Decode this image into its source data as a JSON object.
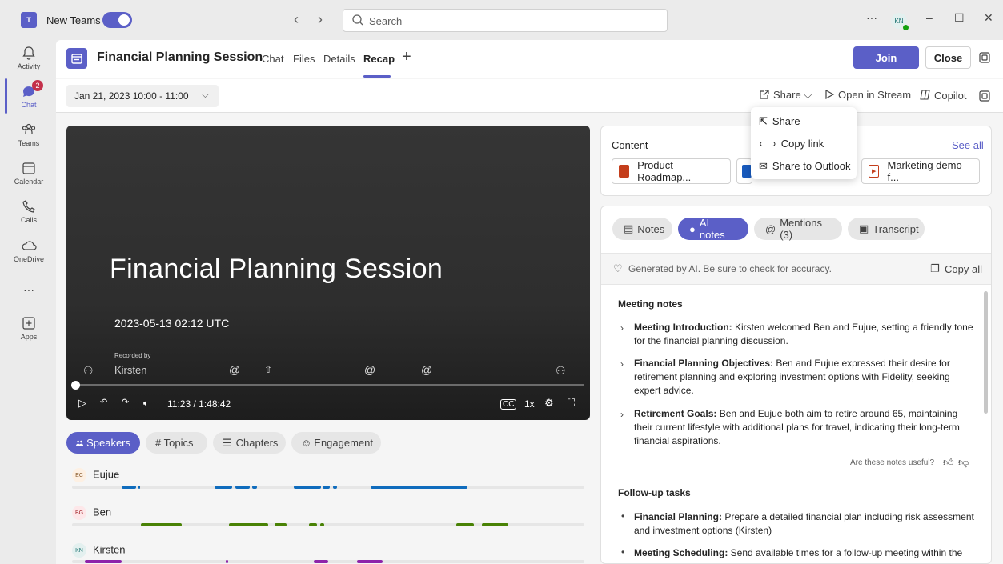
{
  "titlebar": {
    "app_label": "New Teams",
    "search_placeholder": "Search",
    "more": "···",
    "user_initials": "KN",
    "minimize": "–",
    "maximize": "☐",
    "close": "✕"
  },
  "rail": {
    "items": [
      {
        "label": "Activity"
      },
      {
        "label": "Chat",
        "badge": "2"
      },
      {
        "label": "Teams"
      },
      {
        "label": "Calendar"
      },
      {
        "label": "Calls"
      },
      {
        "label": "OneDrive"
      },
      {
        "label": "···"
      },
      {
        "label": "Apps"
      }
    ]
  },
  "header": {
    "title": "Financial Planning Session",
    "tabs": [
      {
        "label": "Chat"
      },
      {
        "label": "Files"
      },
      {
        "label": "Details"
      },
      {
        "label": "Recap",
        "active": true
      }
    ],
    "join_label": "Join",
    "close_label": "Close"
  },
  "toolbar": {
    "date_range": "Jan 21, 2023 10:00 - 11:00",
    "share_label": "Share",
    "stream_label": "Open in Stream",
    "copilot_label": "Copilot"
  },
  "share_menu": {
    "items": [
      {
        "label": "Share"
      },
      {
        "label": "Copy link"
      },
      {
        "label": "Share to Outlook"
      }
    ]
  },
  "video": {
    "title": "Financial Planning Session",
    "datetime": "2023-05-13 02:12 UTC",
    "recorded_by_label": "Recorded by",
    "recorded_by": "Kirsten",
    "time": "11:23 / 1:48:42",
    "speed": "1x"
  },
  "filters": {
    "items": [
      {
        "label": "Speakers",
        "active": true
      },
      {
        "label": "# Topics"
      },
      {
        "label": "Chapters"
      },
      {
        "label": "Engagement"
      }
    ]
  },
  "speakers": [
    {
      "initials": "EC",
      "name": "Eujue",
      "color": "#0f6cbd"
    },
    {
      "initials": "BG",
      "name": "Ben",
      "color": "#498205"
    },
    {
      "initials": "KN",
      "name": "Kirsten",
      "color": "#8e24aa"
    }
  ],
  "content": {
    "heading": "Content",
    "see_all": "See all",
    "files": [
      {
        "name": "Product Roadmap...",
        "type": "pptx"
      },
      {
        "name": "Marketing demo f...",
        "type": "video"
      }
    ]
  },
  "notes": {
    "tabs": [
      {
        "label": "Notes"
      },
      {
        "label": "AI notes",
        "active": true
      },
      {
        "label": "Mentions (3)"
      },
      {
        "label": "Transcript"
      }
    ],
    "ai_disclaimer": "Generated by AI. Be sure to check for accuracy.",
    "copy_all": "Copy all",
    "meeting_notes_heading": "Meeting notes",
    "items": [
      {
        "title": "Meeting Introduction:",
        "text": " Kirsten welcomed Ben and Eujue, setting a friendly tone for the financial planning discussion."
      },
      {
        "title": "Financial Planning Objectives:",
        "text": " Ben and Eujue expressed their desire for retirement planning and exploring investment options with Fidelity, seeking expert advice."
      },
      {
        "title": "Retirement Goals:",
        "text": " Ben and Eujue both aim to retire around 65, maintaining their current lifestyle with additional plans for travel, indicating their long-term financial aspirations."
      }
    ],
    "useful_prompt": "Are these notes useful?",
    "followup_heading": "Follow-up tasks",
    "tasks": [
      {
        "title": "Financial Planning:",
        "text": " Prepare a detailed financial plan including risk assessment and investment options (Kirsten)"
      },
      {
        "title": "Meeting Scheduling:",
        "text": " Send available times for a follow-up meeting within the"
      }
    ]
  }
}
